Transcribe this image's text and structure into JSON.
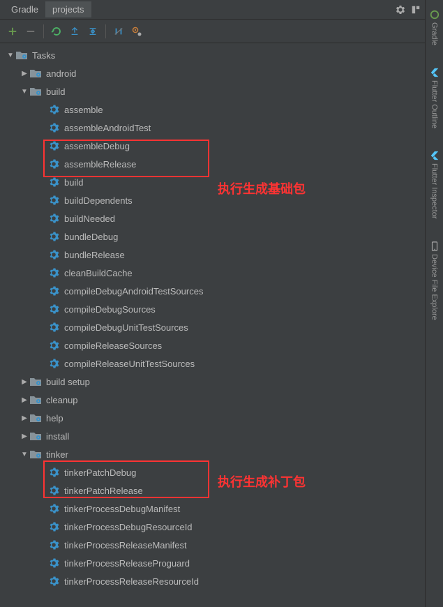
{
  "header": {
    "tabs": [
      "Gradle",
      "projects"
    ]
  },
  "sidebar": {
    "tools": [
      {
        "label": "Gradle",
        "icon": "gradle"
      },
      {
        "label": "Flutter Outline",
        "icon": "flutter"
      },
      {
        "label": "Flutter Inspector",
        "icon": "flutter"
      },
      {
        "label": "Device File Explore",
        "icon": "device"
      }
    ]
  },
  "annotations": {
    "base_package": "执行生成基础包",
    "patch_package": "执行生成补丁包"
  },
  "tree": {
    "root": "Tasks",
    "folders": [
      {
        "name": "android",
        "expanded": false
      },
      {
        "name": "build",
        "expanded": true,
        "tasks": [
          "assemble",
          "assembleAndroidTest",
          "assembleDebug",
          "assembleRelease",
          "build",
          "buildDependents",
          "buildNeeded",
          "bundleDebug",
          "bundleRelease",
          "cleanBuildCache",
          "compileDebugAndroidTestSources",
          "compileDebugSources",
          "compileDebugUnitTestSources",
          "compileReleaseSources",
          "compileReleaseUnitTestSources"
        ]
      },
      {
        "name": "build setup",
        "expanded": false
      },
      {
        "name": "cleanup",
        "expanded": false
      },
      {
        "name": "help",
        "expanded": false
      },
      {
        "name": "install",
        "expanded": false
      },
      {
        "name": "tinker",
        "expanded": true,
        "tasks": [
          "tinkerPatchDebug",
          "tinkerPatchRelease",
          "tinkerProcessDebugManifest",
          "tinkerProcessDebugResourceId",
          "tinkerProcessReleaseManifest",
          "tinkerProcessReleaseProguard",
          "tinkerProcessReleaseResourceId"
        ]
      }
    ]
  }
}
